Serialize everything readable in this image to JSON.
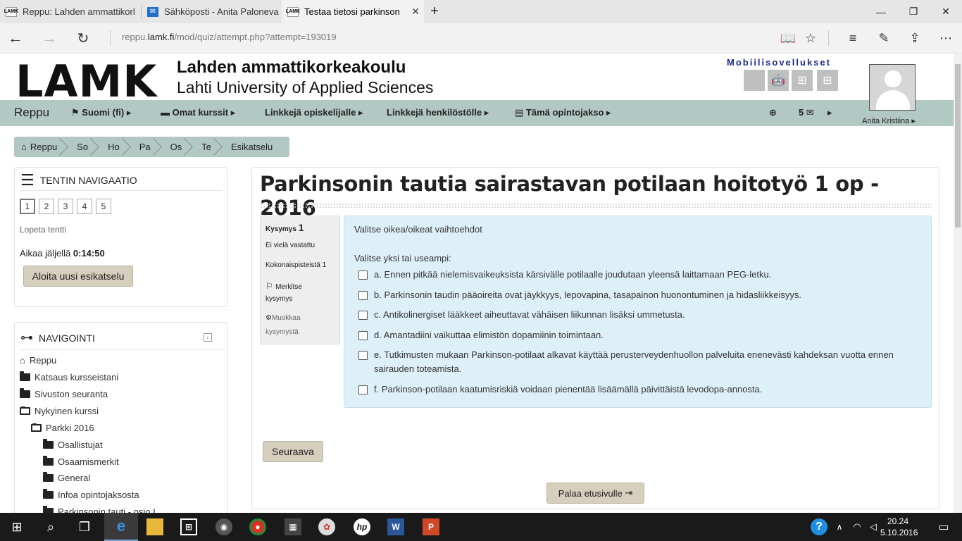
{
  "browser": {
    "tabs": [
      {
        "title": "Reppu: Lahden ammattikorl",
        "favicon": "LAMK"
      },
      {
        "title": "Sähköposti - Anita Paloneva",
        "favicon": "mail-icon"
      },
      {
        "title": "Testaa tietosi parkinson",
        "favicon": "LAMK"
      }
    ],
    "new_tab": "+",
    "url_prefix": "reppu.",
    "url_domain": "lamk.fi",
    "url_path": "/mod/quiz/attempt.php?attempt=193019"
  },
  "header": {
    "logo": "LAMK",
    "uni_fi": "Lahden ammattikorkeakoulu",
    "uni_en": "Lahti University of Applied Sciences",
    "mobile_apps": "Mobiilisovellukset",
    "username": "Anita Kristiina"
  },
  "mainnav": {
    "brand": "Reppu",
    "items": [
      "Suomi (fi)",
      "Omat kurssit",
      "Linkkejä opiskelijalle",
      "Linkkejä henkilöstölle",
      "Tämä opintojakso"
    ],
    "message_count": "5"
  },
  "breadcrumb": [
    "Reppu",
    "So",
    "Ho",
    "Pa",
    "Os",
    "Te",
    "Esikatselu"
  ],
  "quiz_nav": {
    "title": "TENTIN NAVIGAATIO",
    "questions": [
      "1",
      "2",
      "3",
      "4",
      "5"
    ],
    "finish": "Lopeta tentti",
    "time_label": "Aikaa jäljellä",
    "time_value": "0:14:50",
    "restart_button": "Aloita uusi esikatselu"
  },
  "navigation": {
    "title": "NAVIGOINTI",
    "items": [
      "Reppu",
      "Katsaus kursseistani",
      "Sivuston seuranta",
      "Nykyinen kurssi",
      "Parkki 2016",
      "Osallistujat",
      "Osaamismerkit",
      "General",
      "Infoa opintojaksosta",
      "Parkinsonin tauti - osio I"
    ]
  },
  "quiz": {
    "title": "Parkinsonin tautia sairastavan potilaan hoitotyö 1 op - 2016",
    "info": {
      "question_label": "Kysymys",
      "question_number": "1",
      "state": "Ei vielä vastattu",
      "points": "Kokonaispisteistä 1",
      "flag_line1": "Merkitse",
      "flag_line2": "kysymys",
      "edit_line1": "Muokkaa",
      "edit_line2": "kysymystä"
    },
    "prompt": "Valitse oikea/oikeat vaihtoehdot",
    "instruction": "Valitse yksi tai useampi:",
    "options": [
      "a. Ennen pitkää nielemisvaikeuksista kärsivälle potilaalle joudutaan yleensä laittamaan PEG-letku.",
      "b. Parkinsonin taudin pääoireita ovat jäykkyys, lepovapina, tasapainon huonontuminen ja hidasliikkeisyys.",
      "c. Antikolinergiset lääkkeet aiheuttavat vähäisen liikunnan lisäksi ummetusta.",
      "d. Amantadiini vaikuttaa elimistön dopamiinin toimintaan.",
      "e. Tutkimusten mukaan Parkinson-potilaat alkavat käyttää perusterveydenhuollon palveluita enenevästi kahdeksan vuotta ennen sairauden toteamista.",
      "f. Parkinson-potilaan kaatumisriskiä voidaan pienentää lisäämällä päivittäistä levodopa-annosta."
    ],
    "next_button": "Seuraava",
    "back_button": "Palaa etusivulle"
  },
  "taskbar": {
    "time": "20.24",
    "date": "5.10.2016"
  }
}
